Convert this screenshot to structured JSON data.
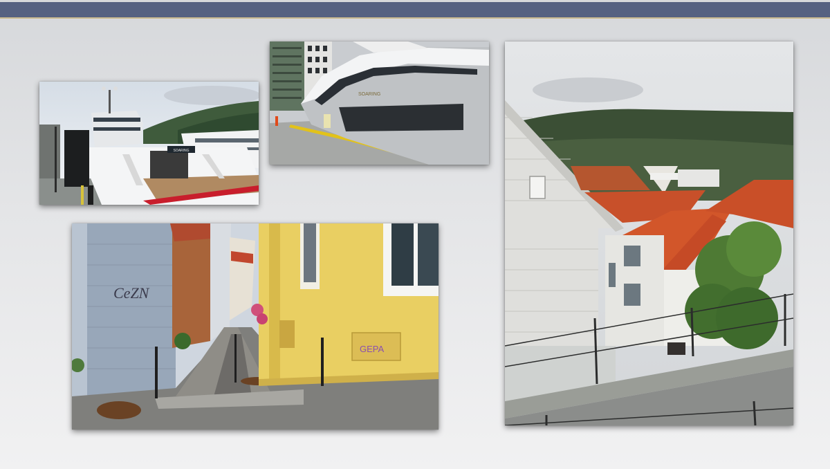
{
  "slide": {
    "header_bar_color": "#556181",
    "header_rule_color": "#c9b98f"
  },
  "photos": [
    {
      "id": "yacht-stern",
      "yacht_name": "SOARING",
      "subject": "superyacht-icon"
    },
    {
      "id": "yacht-bow",
      "yacht_name": "SOARING",
      "subject": "superyacht-icon"
    },
    {
      "id": "alley",
      "graffiti_wall": "CeZN",
      "graffiti_box": "GEPA",
      "subject": "street-icon"
    },
    {
      "id": "rooftops",
      "subject": "houses-icon"
    }
  ]
}
